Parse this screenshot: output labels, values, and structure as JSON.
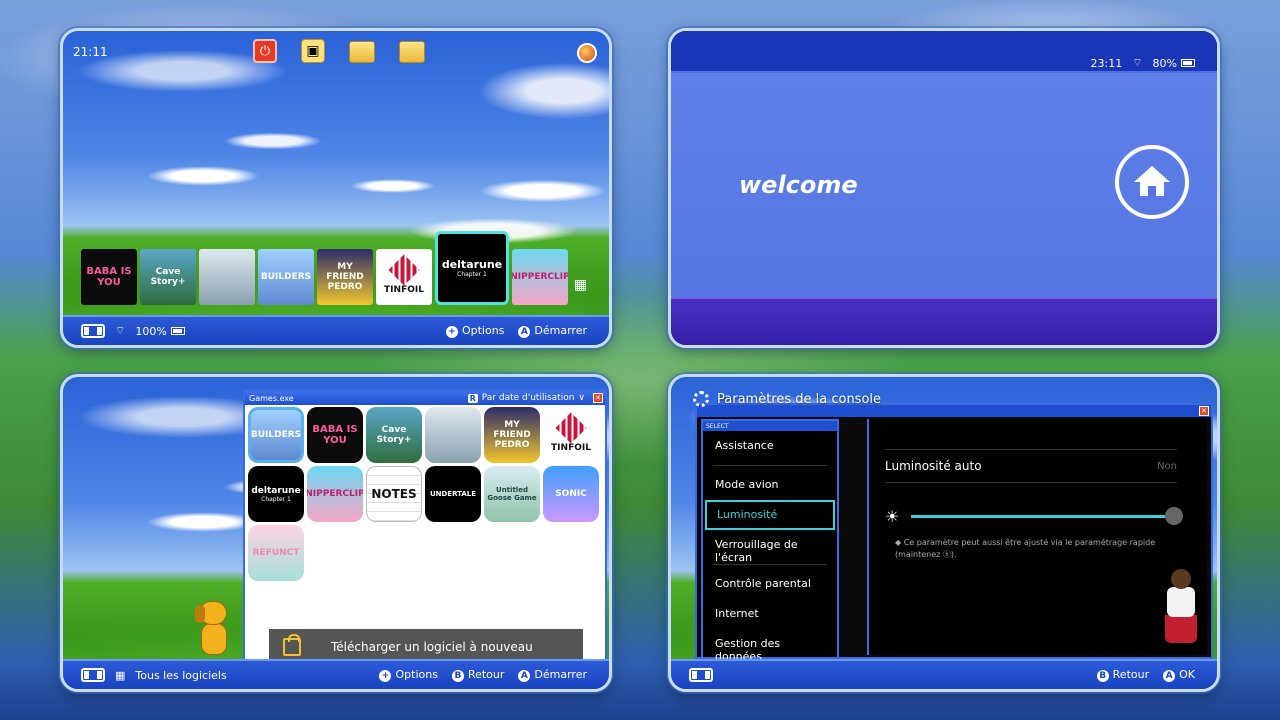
{
  "panel1": {
    "time": "21:11",
    "top_icons": [
      "power-icon",
      "album-icon",
      "folder-icon",
      "folder-icon"
    ],
    "games": [
      {
        "name": "baba-is-you",
        "label": "BABA IS YOU"
      },
      {
        "name": "cave-story",
        "label": "Cave Story+"
      },
      {
        "name": "goat-simulator",
        "label": ""
      },
      {
        "name": "lego-builders",
        "label": "BUILDERS"
      },
      {
        "name": "my-friend-pedro",
        "label": "MY FRIEND PEDRO"
      },
      {
        "name": "tinfoil",
        "label": "TINFOIL"
      },
      {
        "name": "deltarune",
        "label": "deltarune",
        "sub": "Chapter 1"
      },
      {
        "name": "snipperclips",
        "label": "SNIPPERCLIPS"
      }
    ],
    "battery": "100%",
    "options_label": "Options",
    "start_label": "Démarrer",
    "btn_plus": "+",
    "btn_a": "A"
  },
  "panel2": {
    "time": "23:11",
    "battery": "80%",
    "welcome": "welcome"
  },
  "panel3": {
    "window_title": "Games.exe",
    "sort_badge": "R",
    "sort_label": "Par date d'utilisation",
    "games": [
      {
        "name": "lego-builders",
        "label": "BUILDERS"
      },
      {
        "name": "baba-is-you",
        "label": "BABA IS YOU"
      },
      {
        "name": "cave-story",
        "label": "Cave Story+"
      },
      {
        "name": "goat-simulator",
        "label": ""
      },
      {
        "name": "my-friend-pedro",
        "label": "MY FRIEND PEDRO"
      },
      {
        "name": "tinfoil",
        "label": "TINFOIL"
      },
      {
        "name": "deltarune",
        "label": "deltarune",
        "sub": "Chapter 1"
      },
      {
        "name": "snipperclips",
        "label": "SNIPPERCLIPS"
      },
      {
        "name": "notes",
        "label": "NOTES"
      },
      {
        "name": "undertale",
        "label": "UNDERTALE"
      },
      {
        "name": "untitled-goose-game",
        "label": "Untitled Goose Game"
      },
      {
        "name": "sonic-colors",
        "label": "SONIC"
      },
      {
        "name": "refunct",
        "label": "REFUNCT"
      }
    ],
    "download_label": "Télécharger un logiciel à nouveau",
    "all_software": "Tous les logiciels",
    "options_label": "Options",
    "back_label": "Retour",
    "start_label": "Démarrer",
    "btn_plus": "+",
    "btn_b": "B",
    "btn_a": "A"
  },
  "panel4": {
    "title": "Paramètres de la console",
    "menu_title": "SELECT",
    "menu": [
      "Assistance",
      "Mode avion",
      "Luminosité",
      "Verrouillage de l'écran",
      "Contrôle parental",
      "Internet",
      "Gestion des données"
    ],
    "active_index": 2,
    "setting_label": "Luminosité auto",
    "setting_value": "Non",
    "brightness_level": 1.0,
    "note": "Ce paramètre peut aussi être ajusté via le paramétrage rapide (maintenez ⓗ).",
    "back_label": "Retour",
    "ok_label": "OK",
    "btn_b": "B",
    "btn_a": "A"
  }
}
